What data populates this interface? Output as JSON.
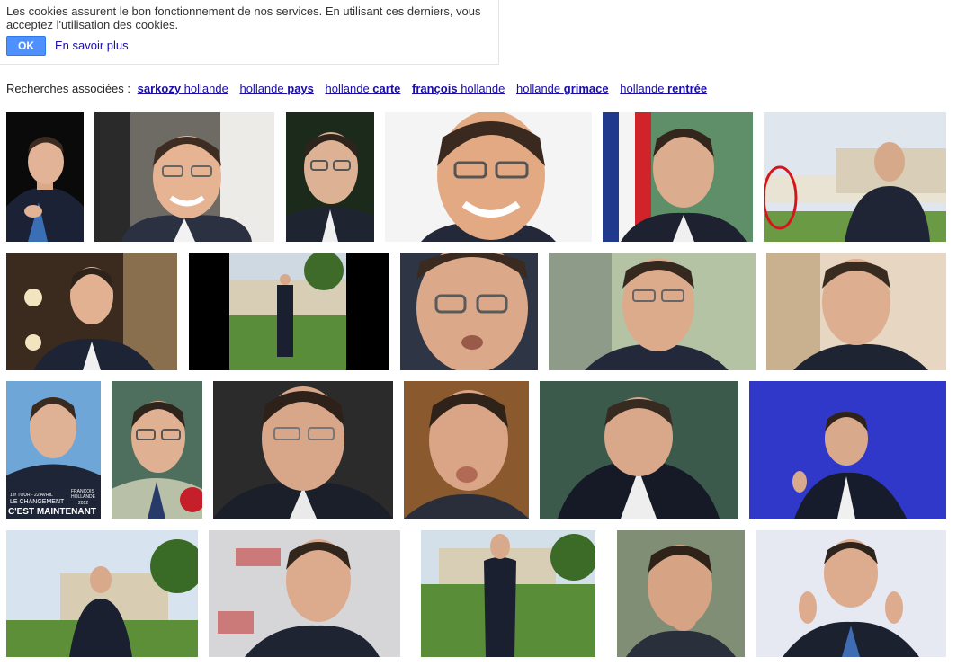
{
  "cookie_banner": {
    "text": "Les cookies assurent le bon fonctionnement de nos services. En utilisant ces derniers, vous acceptez l'utilisation des cookies.",
    "ok_label": "OK",
    "more_label": "En savoir plus"
  },
  "related": {
    "label": "Recherches associées :",
    "items": [
      {
        "bold": "sarkozy",
        "rest": " hollande",
        "bold_first": true
      },
      {
        "bold": "pays",
        "rest": "hollande ",
        "bold_first": false
      },
      {
        "bold": "carte",
        "rest": "hollande ",
        "bold_first": false
      },
      {
        "bold": "françois",
        "rest": " hollande",
        "bold_first": true
      },
      {
        "bold": "grimace",
        "rest": "hollande ",
        "bold_first": false
      },
      {
        "bold": "rentrée",
        "rest": "hollande ",
        "bold_first": false
      }
    ]
  },
  "poster_text": {
    "line1": "1er TOUR - 22 AVRIL",
    "line2": "LE CHANGEMENT",
    "line3": "C'EST MAINTENANT",
    "name1": "FRANÇOIS",
    "name2": "HOLLANDE",
    "year": "2012"
  },
  "colors": {
    "link": "#1a0dab",
    "ok_button": "#4d90fe",
    "banner_border": "#e4e4e4"
  }
}
